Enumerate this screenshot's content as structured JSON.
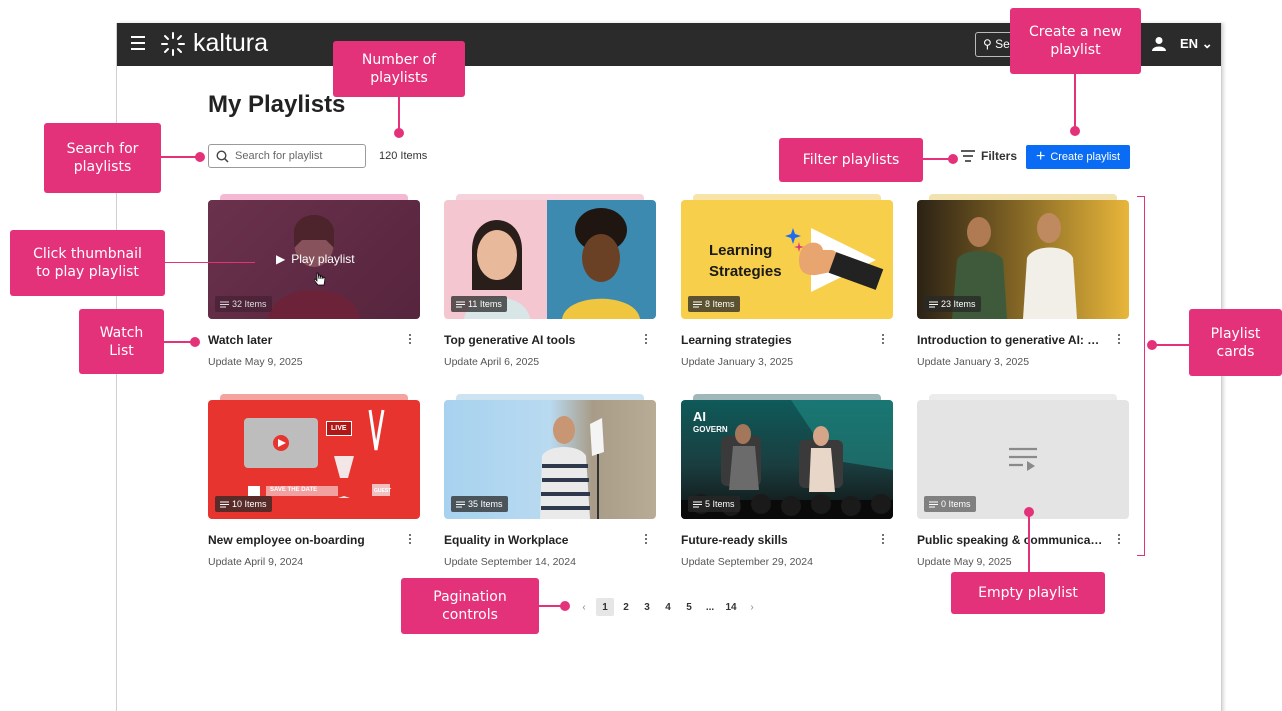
{
  "app": {
    "brand": "kaltura",
    "search_peek": "Se",
    "language": "EN"
  },
  "page": {
    "title": "My Playlists",
    "search_placeholder": "Search for playlist",
    "items_count": "120 Items",
    "filters_label": "Filters",
    "create_label": "Create playlist"
  },
  "cards": [
    {
      "title": "Watch later",
      "date": "Update May 9, 2025",
      "items": "32 Items",
      "hover_label": "Play playlist"
    },
    {
      "title": "Top generative AI tools",
      "date": "Update April 6, 2025",
      "items": "11 Items"
    },
    {
      "title": "Learning strategies",
      "date": "Update January 3, 2025",
      "items": "8 Items",
      "thumb_text_1": "Learning",
      "thumb_text_2": "Strategies"
    },
    {
      "title": "Introduction to generative AI: U...",
      "date": "Update January 3, 2025",
      "items": "23 Items"
    },
    {
      "title": "New employee on-boarding",
      "date": "Update April 9, 2024",
      "items": "10 Items",
      "thumb_text_1": "LIVE",
      "thumb_text_2": "SAVE THE DATE",
      "thumb_text_3": "GUEST"
    },
    {
      "title": "Equality in Workplace",
      "date": "Update September 14, 2024",
      "items": "35 Items"
    },
    {
      "title": "Future-ready skills",
      "date": "Update September 29, 2024",
      "items": "5 Items",
      "thumb_text_1": "AI",
      "thumb_text_2": "GOVERN"
    },
    {
      "title": "Public speaking & communicatio...",
      "date": "Update May 9, 2025",
      "items": "0 Items"
    }
  ],
  "pagination": {
    "prev": "‹",
    "pages": [
      "1",
      "2",
      "3",
      "4",
      "5",
      "...",
      "14"
    ],
    "next": "›",
    "current": "1"
  },
  "annotations": {
    "number_of_playlists": "Number of\nplaylists",
    "search_for_playlists": "Search for\nplaylists",
    "click_thumbnail": "Click thumbnail\nto play playlist",
    "watch_list": "Watch\nList",
    "filter_playlists": "Filter playlists",
    "create_new_playlist": "Create a new\nplaylist",
    "playlist_cards": "Playlist\ncards",
    "pagination_controls": "Pagination\ncontrols",
    "empty_playlist": "Empty playlist"
  },
  "colors": {
    "accent": "#e4327a",
    "primary_button": "#0a6cf5",
    "topbar": "#2b2b2b"
  }
}
